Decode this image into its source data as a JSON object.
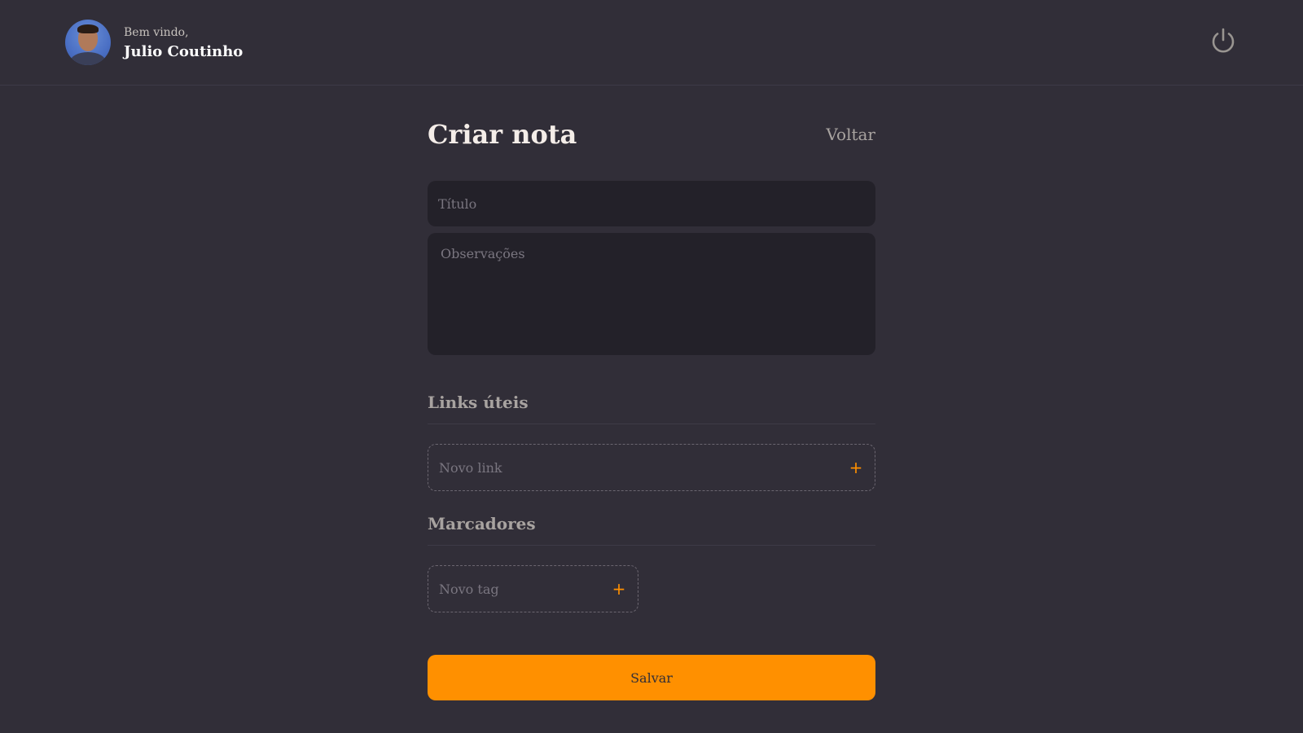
{
  "header": {
    "welcome_text": "Bem vindo,",
    "user_name": "Julio Coutinho",
    "logout_icon": "power-icon"
  },
  "page": {
    "title": "Criar nota",
    "back_label": "Voltar"
  },
  "form": {
    "title_placeholder": "Título",
    "notes_placeholder": "Observações",
    "links_section_title": "Links úteis",
    "new_link_placeholder": "Novo link",
    "tags_section_title": "Marcadores",
    "new_tag_placeholder": "Novo tag",
    "add_icon_glyph": "+",
    "save_label": "Salvar"
  },
  "colors": {
    "background": "#312e38",
    "input_background": "#232129",
    "accent": "#ff9000",
    "muted_text": "#a8a3a0"
  }
}
